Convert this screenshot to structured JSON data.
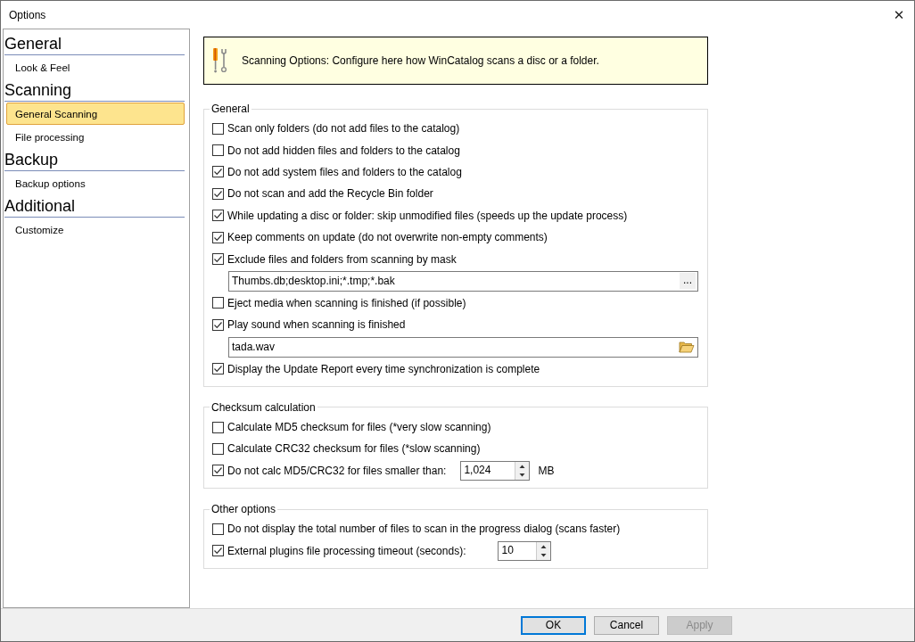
{
  "window": {
    "title": "Options",
    "close": "✕"
  },
  "sidebar": {
    "groups": [
      {
        "title": "General",
        "items": [
          {
            "label": "Look & Feel",
            "selected": false
          }
        ]
      },
      {
        "title": "Scanning",
        "items": [
          {
            "label": "General Scanning",
            "selected": true
          },
          {
            "label": "File processing",
            "selected": false
          }
        ]
      },
      {
        "title": "Backup",
        "items": [
          {
            "label": "Backup options",
            "selected": false
          }
        ]
      },
      {
        "title": "Additional",
        "items": [
          {
            "label": "Customize",
            "selected": false
          }
        ]
      }
    ]
  },
  "banner": {
    "text": "Scanning Options: Configure here how WinCatalog scans a disc or a folder."
  },
  "sections": [
    {
      "title": "General",
      "items": [
        {
          "kind": "checkbox",
          "label": "Scan only folders (do not add files to the catalog)",
          "checked": false
        },
        {
          "kind": "checkbox",
          "label": "Do not add hidden files and folders to the catalog",
          "checked": false
        },
        {
          "kind": "checkbox",
          "label": "Do not add system files and folders to the catalog",
          "checked": true
        },
        {
          "kind": "checkbox",
          "label": "Do not scan and add the Recycle Bin folder",
          "checked": true
        },
        {
          "kind": "checkbox",
          "label": "While updating a disc or folder: skip unmodified files (speeds up the update process)",
          "checked": true
        },
        {
          "kind": "checkbox",
          "label": "Keep comments on update (do not overwrite non-empty comments)",
          "checked": true
        },
        {
          "kind": "checkbox",
          "label": "Exclude files and folders from scanning by mask",
          "checked": true
        },
        {
          "kind": "mask-field",
          "value": "Thumbs.db;desktop.ini;*.tmp;*.bak",
          "button": "..."
        },
        {
          "kind": "checkbox",
          "label": "Eject media when scanning is finished (if possible)",
          "checked": false
        },
        {
          "kind": "checkbox",
          "label": "Play sound when scanning is finished",
          "checked": true
        },
        {
          "kind": "file-field",
          "value": "tada.wav"
        },
        {
          "kind": "checkbox",
          "label": "Display the Update Report every time synchronization is complete",
          "checked": true
        }
      ]
    },
    {
      "title": "Checksum calculation",
      "items": [
        {
          "kind": "checkbox",
          "label": "Calculate MD5 checksum for files (*very slow scanning)",
          "checked": false
        },
        {
          "kind": "checkbox",
          "label": "Calculate CRC32 checksum for files (*slow scanning)",
          "checked": false
        },
        {
          "kind": "spin",
          "label": "Do not calc MD5/CRC32 for files smaller than:",
          "checked": true,
          "value": "1,024",
          "unit": "MB"
        }
      ]
    },
    {
      "title": "Other options",
      "items": [
        {
          "kind": "checkbox",
          "label": "Do not display the total number of files to scan in the progress dialog (scans faster)",
          "checked": false
        },
        {
          "kind": "spin",
          "label": "External plugins file processing timeout (seconds):",
          "checked": true,
          "value": "10"
        }
      ]
    }
  ],
  "buttons": [
    {
      "label": "OK",
      "kind": "default",
      "disabled": false
    },
    {
      "label": "Cancel",
      "kind": "normal",
      "disabled": false
    },
    {
      "label": "Apply",
      "kind": "normal",
      "disabled": true
    }
  ]
}
